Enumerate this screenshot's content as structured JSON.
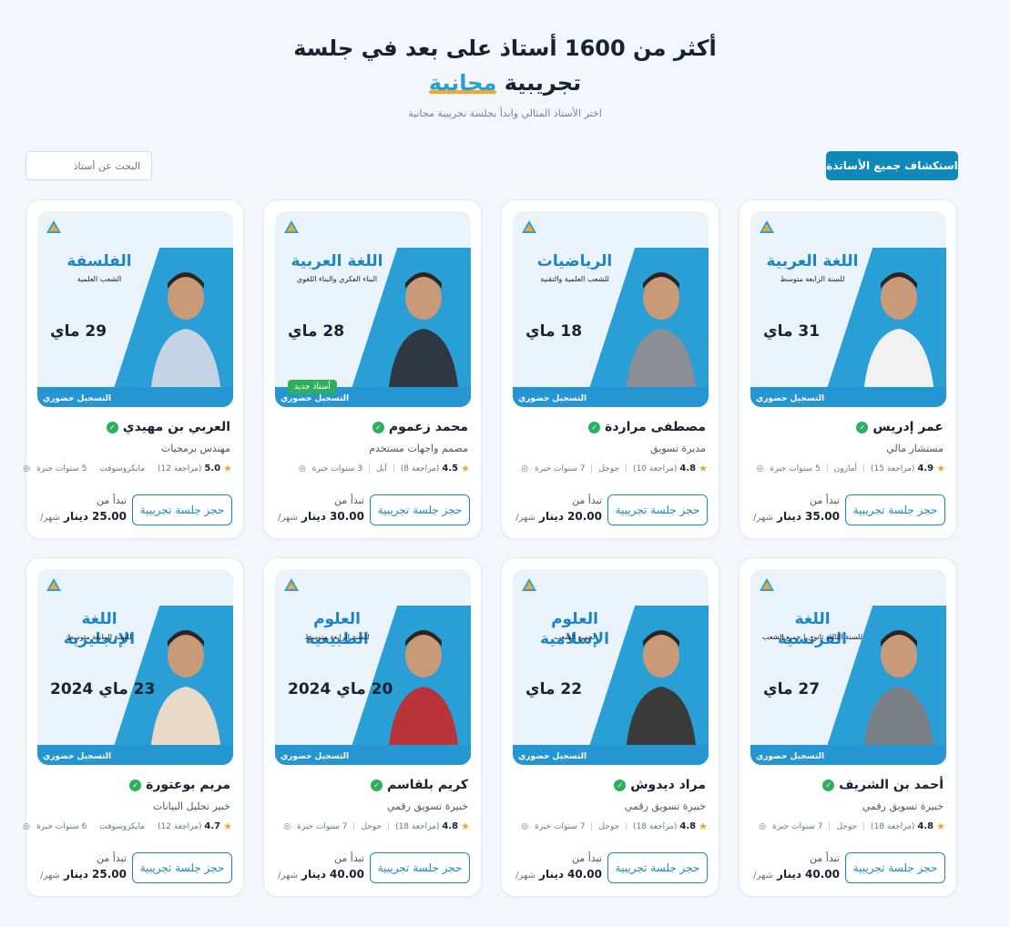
{
  "hero": {
    "title_line1": "أكثر من 1600 أستاذ على بعد في جلسة",
    "title_line2_prefix": "تجريبية",
    "title_line2_accent": "مجانية",
    "subtitle": "اختر الأستاذ المثالي وابدأ بجلسة تجريبية مجانية"
  },
  "toolbar": {
    "explore_label": "استكشاف جميع الأساتذة",
    "search_placeholder": "البحث عن أستاذ"
  },
  "labels": {
    "book": "حجز جلسة تجريبية",
    "from": "تبدأ من",
    "currency": "دينار",
    "per": "شهر/",
    "new_teacher": "أستاذ جديد",
    "register": "التسجيل حضوري"
  },
  "colors": {
    "accent": "#0f8ab8",
    "brand_blue": "#27a0cf",
    "highlight": "#f2a531",
    "verified": "#2eaf5f"
  },
  "tutors": [
    {
      "name": "عمر إدريس",
      "role": "مستشار مالي",
      "rating": "4.9",
      "reviews": "(مراجعة 15)",
      "company": "أمازون",
      "experience": "5 سنوات خبرة",
      "price": "35.00",
      "poster_subject": "اللغة العربية",
      "poster_sub": "للسنة الرابعة متوسط",
      "poster_date": "31 ماي"
    },
    {
      "name": "مصطفى مراردة",
      "role": "مديرة تسويق",
      "rating": "4.8",
      "reviews": "(مراجعة 10)",
      "company": "جوجل",
      "experience": "7 سنوات خبرة",
      "price": "20.00",
      "poster_subject": "الرياضيات",
      "poster_sub": "للشعب العلمية والتقنية",
      "poster_date": "18 ماي"
    },
    {
      "name": "محمد زعموم",
      "role": "مصمم واجهات مستخدم",
      "rating": "4.5",
      "reviews": "(مراجعة 8)",
      "company": "آبل",
      "experience": "3 سنوات خبرة",
      "price": "30.00",
      "poster_subject": "اللغة العربية",
      "poster_sub": "البناء الفكري والبناء اللغوي",
      "poster_date": "28 ماي"
    },
    {
      "name": "العربي بن مهيدي",
      "role": "مهندس برمجيات",
      "rating": "5.0",
      "reviews": "(مراجعة 12)",
      "company": "مايكروسوفت",
      "experience": "5 سنوات خبرة",
      "price": "25.00",
      "poster_subject": "الفلسفة",
      "poster_sub": "الشعب العلمية",
      "poster_date": "29 ماي"
    },
    {
      "name": "أحمد بن الشريف",
      "role": "خبيرة تسويق رقمي",
      "rating": "4.8",
      "reviews": "(مراجعة 18)",
      "company": "جوجل",
      "experience": "7 سنوات خبرة",
      "price": "40.00",
      "poster_subject": "اللغة الفرنسية",
      "poster_sub": "للسنة الثالثة ثانوي | جميع الشعب",
      "poster_date": "27 ماي"
    },
    {
      "name": "مراد ديدوش",
      "role": "خبيرة تسويق رقمي",
      "rating": "4.8",
      "reviews": "(مراجعة 18)",
      "company": "جوجل",
      "experience": "7 سنوات خبرة",
      "price": "40.00",
      "poster_subject": "العلوم الإسلامية",
      "poster_sub": "لجميع الشعب",
      "poster_date": "22 ماي"
    },
    {
      "name": "كريم بلقاسم",
      "role": "خبيرة تسويق رقمي",
      "rating": "4.8",
      "reviews": "(مراجعة 18)",
      "company": "جوجل",
      "experience": "7 سنوات خبرة",
      "price": "40.00",
      "poster_subject": "العلوم الطبيعية",
      "poster_sub": "للسنة الرابعة متوسط",
      "poster_date": "20 ماي 2024"
    },
    {
      "name": "مريم بوعتورة",
      "role": "خبير تحليل البيانات",
      "rating": "4.7",
      "reviews": "(مراجعة 12)",
      "company": "مايكروسوفت",
      "experience": "6 سنوات خبرة",
      "price": "25.00",
      "poster_subject": "اللغة الإنجليزية",
      "poster_sub": "للسنة الرابعة متوسط",
      "poster_date": "23 ماي 2024"
    }
  ]
}
